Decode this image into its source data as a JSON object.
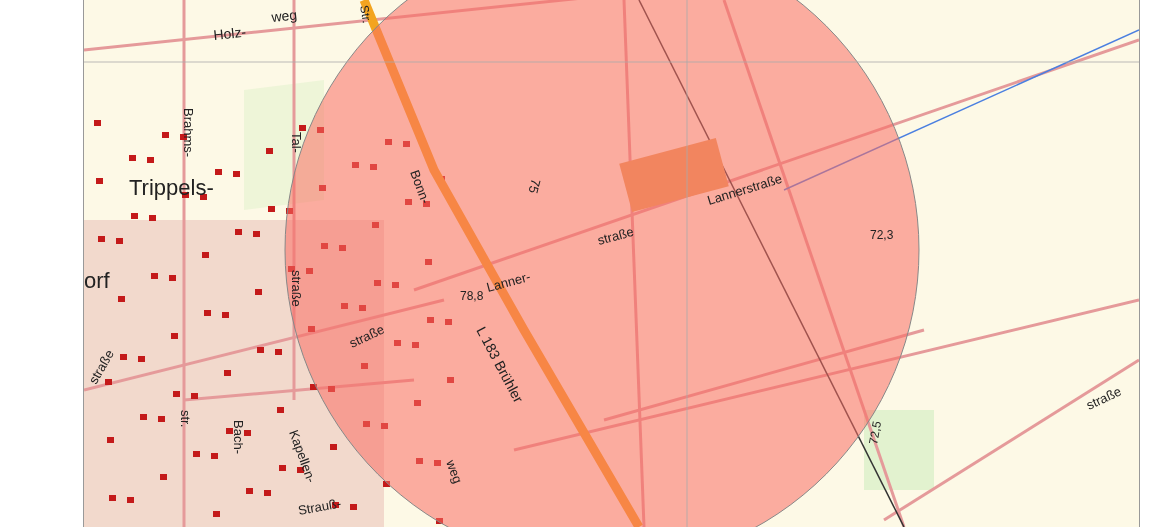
{
  "map": {
    "labels": [
      {
        "text": "Holz-"
      },
      {
        "text": "weg"
      },
      {
        "text": "Str."
      },
      {
        "text": "Brahms-"
      },
      {
        "text": "Tal-"
      },
      {
        "text": "Trippels-"
      },
      {
        "text": "orf"
      },
      {
        "text": "Bonn-"
      },
      {
        "text": "straße"
      },
      {
        "text": "Lanner-"
      },
      {
        "text": "straße"
      },
      {
        "text": "Lannerstraße"
      },
      {
        "text": "78,8"
      },
      {
        "text": "72,3"
      },
      {
        "text": "75"
      },
      {
        "text": "L 183 Brühler"
      },
      {
        "text": "straße"
      },
      {
        "text": "straße"
      },
      {
        "text": "str."
      },
      {
        "text": "Bach-"
      },
      {
        "text": "Kapellen-"
      },
      {
        "text": "Strauß-"
      },
      {
        "text": "weg"
      },
      {
        "text": "straße"
      },
      {
        "text": "72,5"
      }
    ]
  }
}
